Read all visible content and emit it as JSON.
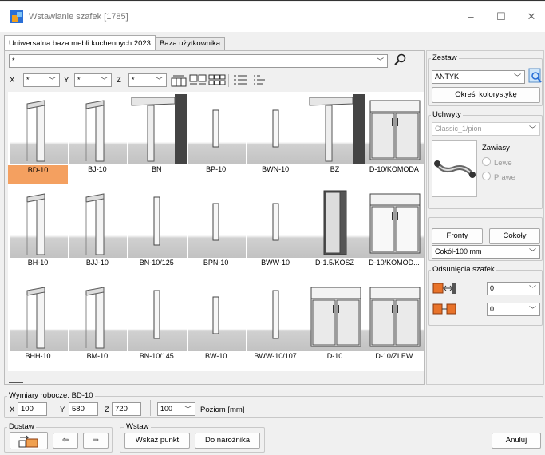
{
  "window": {
    "title": "Wstawianie szafek [1785]",
    "minimize": "–",
    "maximize": "☐",
    "close": "✕"
  },
  "tabs": [
    {
      "label": "Uniwersalna baza mebli kuchennych 2023"
    },
    {
      "label": "Baza użytkownika"
    }
  ],
  "filter": {
    "value": "*",
    "x_label": "X",
    "x_value": "*",
    "y_label": "Y",
    "y_value": "*",
    "z_label": "Z",
    "z_value": "*"
  },
  "items": [
    {
      "name": "BD-10",
      "selected": true
    },
    {
      "name": "BJ-10"
    },
    {
      "name": "BN"
    },
    {
      "name": "BP-10"
    },
    {
      "name": "BWN-10"
    },
    {
      "name": "BZ"
    },
    {
      "name": "D-10/KOMODA"
    },
    {
      "name": "BH-10"
    },
    {
      "name": "BJJ-10"
    },
    {
      "name": "BN-10/125"
    },
    {
      "name": "BPN-10"
    },
    {
      "name": "BWW-10"
    },
    {
      "name": "D-1.5/KOSZ"
    },
    {
      "name": "D-10/KOMOD..."
    },
    {
      "name": "BHH-10"
    },
    {
      "name": "BM-10"
    },
    {
      "name": "BN-10/145"
    },
    {
      "name": "BW-10"
    },
    {
      "name": "BWW-10/107"
    },
    {
      "name": "D-10"
    },
    {
      "name": "D-10/ZLEW"
    }
  ],
  "zestaw": {
    "title": "Zestaw",
    "value": "ANTYK",
    "button": "Określ kolorystykę"
  },
  "uchwyty": {
    "title": "Uchwyty",
    "value": "Classic_1/pion",
    "zawiasy": "Zawiasy",
    "lewe": "Lewe",
    "prawe": "Prawe"
  },
  "fronty": {
    "fronty_button": "Fronty",
    "cokoly_button": "Cokoły",
    "cokol_value": "Cokół-100 mm"
  },
  "odsuniecia": {
    "title": "Odsunięcia szafek",
    "first": "0",
    "second": "0"
  },
  "wymiary": {
    "title": "Wymiary robocze: BD-10",
    "x_label": "X",
    "x": "100",
    "y_label": "Y",
    "y": "580",
    "z_label": "Z",
    "z": "720",
    "poziom": "100",
    "poziom_label": "Poziom [mm]"
  },
  "dostaw": {
    "title": "Dostaw",
    "prev": "⇦",
    "next": "⇨"
  },
  "wstaw": {
    "title": "Wstaw",
    "wskaz": "Wskaż punkt",
    "naroznik": "Do narożnika"
  },
  "anuluj": "Anuluj",
  "colors": {
    "selected": "#f4a060",
    "handle": "#e8732a"
  }
}
